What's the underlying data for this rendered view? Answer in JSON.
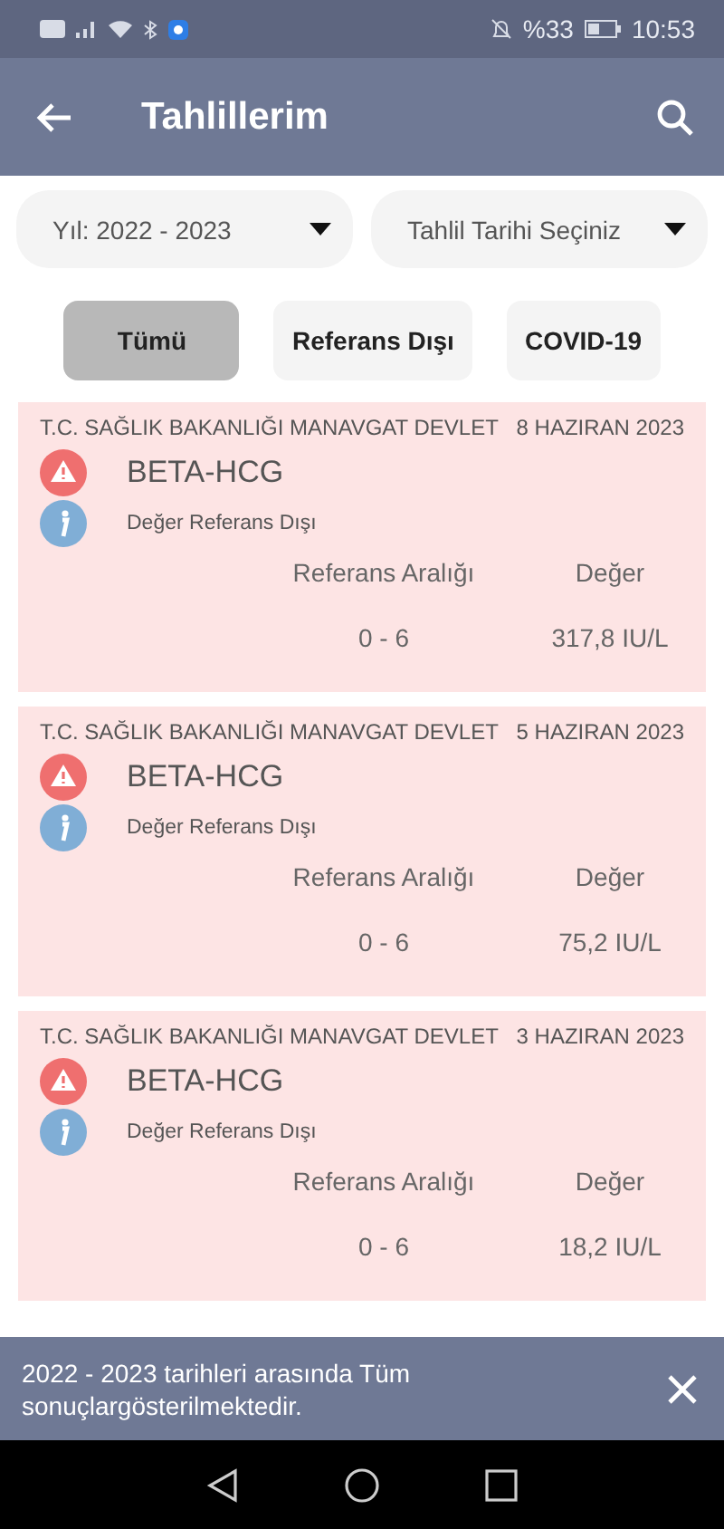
{
  "status_bar": {
    "battery": "%33",
    "time": "10:53"
  },
  "header": {
    "title": "Tahlillerim"
  },
  "dropdowns": [
    {
      "value": "Yıl: 2022 - 2023"
    },
    {
      "value": "Tahlil Tarihi Seçiniz"
    }
  ],
  "filters": [
    {
      "label": "Tümü",
      "selected": true
    },
    {
      "label": "Referans Dışı",
      "selected": false
    },
    {
      "label": "COVID-19",
      "selected": false
    }
  ],
  "results": [
    {
      "hospital": "T.C. SAĞLIK BAKANLIĞI MANAVGAT DEVLET",
      "date": "8 HAZIRAN 2023",
      "test": "BETA-HCG",
      "note": "Değer Referans Dışı",
      "out_of_range": true,
      "range_label": "Referans Aralığı",
      "value_label": "Değer",
      "range": "0 - 6",
      "value": "317,8 IU/L"
    },
    {
      "hospital": "T.C. SAĞLIK BAKANLIĞI MANAVGAT DEVLET",
      "date": "5 HAZIRAN 2023",
      "test": "BETA-HCG",
      "note": "Değer Referans Dışı",
      "out_of_range": true,
      "range_label": "Referans Aralığı",
      "value_label": "Değer",
      "range": "0 - 6",
      "value": "75,2 IU/L"
    },
    {
      "hospital": "T.C. SAĞLIK BAKANLIĞI MANAVGAT DEVLET",
      "date": "3 HAZIRAN 2023",
      "test": "BETA-HCG",
      "note": "Değer Referans Dışı",
      "out_of_range": true,
      "range_label": "Referans Aralığı",
      "value_label": "Değer",
      "range": "0 - 6",
      "value": "18,2 IU/L"
    }
  ],
  "snackbar": {
    "message": "2022 - 2023 tarihleri arasında Tüm sonuçlargösterilmektedir."
  }
}
